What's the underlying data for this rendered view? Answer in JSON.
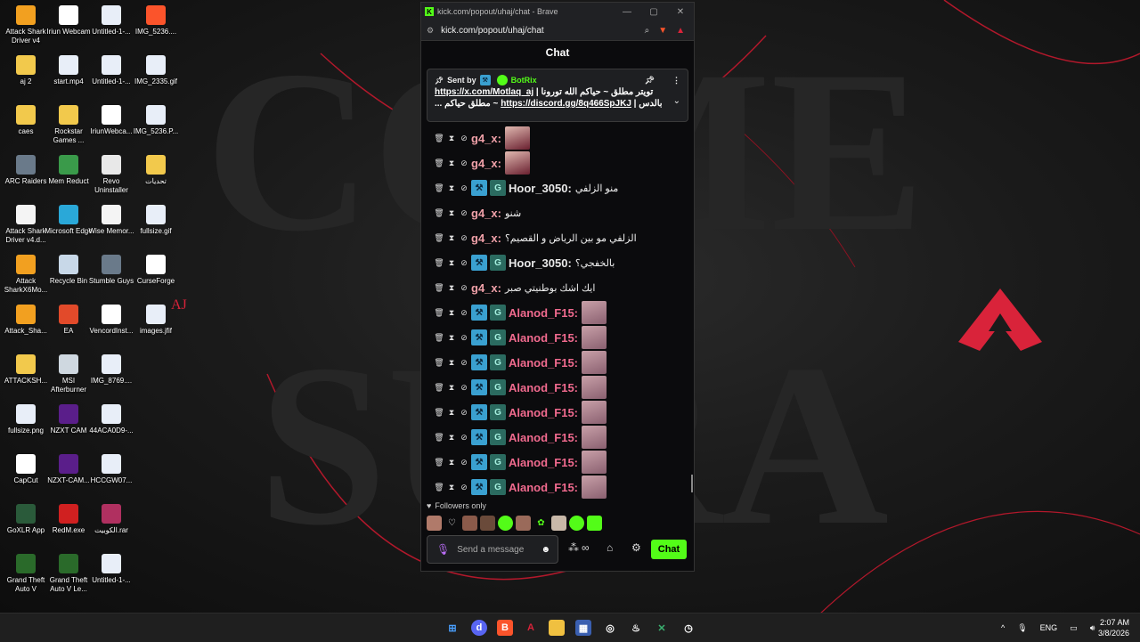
{
  "wallpaper": {
    "letters_top": "COME",
    "letters_bottom": "SURA"
  },
  "desktop_icons": [
    {
      "label": "Attack Shark Driver v4",
      "icon": "mouse-driver-icon"
    },
    {
      "label": "Iriun Webcam",
      "icon": "webcam-icon"
    },
    {
      "label": "Untitled-1-...",
      "icon": "image-file-icon"
    },
    {
      "label": "IMG_5236....",
      "icon": "brave-icon"
    },
    {
      "label": "aj 2",
      "icon": "folder-icon"
    },
    {
      "label": "start.mp4",
      "icon": "video-file-icon"
    },
    {
      "label": "Untitled-1-...",
      "icon": "image-file-icon"
    },
    {
      "label": "IMG_2335.gif",
      "icon": "image-file-icon"
    },
    {
      "label": "caes",
      "icon": "folder-icon"
    },
    {
      "label": "Rockstar Games ...",
      "icon": "rockstar-icon"
    },
    {
      "label": "IriunWebca...",
      "icon": "webcam-icon"
    },
    {
      "label": "IMG_5236.P...",
      "icon": "image-file-icon"
    },
    {
      "label": "ARC Raiders",
      "icon": "game-icon"
    },
    {
      "label": "Mem Reduct",
      "icon": "memory-icon"
    },
    {
      "label": "Revo Uninstaller",
      "icon": "uninstaller-icon"
    },
    {
      "label": "تحديات",
      "icon": "folder-icon"
    },
    {
      "label": "Attack Shark Driver v4.d...",
      "icon": "document-icon"
    },
    {
      "label": "Microsoft Edge",
      "icon": "edge-icon"
    },
    {
      "label": "Wise Memor...",
      "icon": "document-icon"
    },
    {
      "label": "fullsize.gif",
      "icon": "image-file-icon"
    },
    {
      "label": "Attack SharkX6Mo...",
      "icon": "mouse-driver-icon"
    },
    {
      "label": "Recycle Bin",
      "icon": "recycle-bin-icon"
    },
    {
      "label": "Stumble Guys",
      "icon": "game-icon"
    },
    {
      "label": "CurseForge",
      "icon": "curseforge-icon"
    },
    {
      "label": "Attack_Sha...",
      "icon": "mouse-driver-icon"
    },
    {
      "label": "EA",
      "icon": "ea-icon"
    },
    {
      "label": "VencordInst...",
      "icon": "vencord-icon"
    },
    {
      "label": "images.jfif",
      "icon": "image-file-icon"
    },
    {
      "label": "ATTACKSH...",
      "icon": "folder-icon"
    },
    {
      "label": "MSI Afterburner",
      "icon": "afterburner-icon"
    },
    {
      "label": "IMG_8769....",
      "icon": "image-file-icon"
    },
    {
      "label": "fullsize.png",
      "icon": "image-file-icon"
    },
    {
      "label": "NZXT CAM",
      "icon": "nzxt-icon"
    },
    {
      "label": "44ACA0D9-...",
      "icon": "image-file-icon"
    },
    {
      "label": "CapCut",
      "icon": "capcut-icon"
    },
    {
      "label": "NZXT-CAM...",
      "icon": "nzxt-icon"
    },
    {
      "label": "HCCGW07...",
      "icon": "image-file-icon"
    },
    {
      "label": "GoXLR App",
      "icon": "goxlr-icon"
    },
    {
      "label": "RedM.exe",
      "icon": "redm-icon"
    },
    {
      "label": "الكوبيت.rar",
      "icon": "archive-icon"
    },
    {
      "label": "Grand Theft Auto V",
      "icon": "gta-icon"
    },
    {
      "label": "Grand Theft Auto V Le...",
      "icon": "gta-icon"
    },
    {
      "label": "Untitled-1-...",
      "icon": "image-file-icon"
    }
  ],
  "browser": {
    "title": "kick.com/popout/uhaj/chat - Brave",
    "url": "kick.com/popout/uhaj/chat",
    "min": "—",
    "max": "▢",
    "close": "✕"
  },
  "chat": {
    "header": "Chat",
    "pinned": {
      "sent_by": "Sent by",
      "bot": "BotRix",
      "line1_link": "https://x.com/Motlaq_aj",
      "line1_rest": " | تويتر مطلق ~ حياكم الله تورونا",
      "line2_prefix": "... مطلق حياكم ~ ",
      "line2_link": "https://discord.gg/8q466SpJKJ",
      "line2_rest": " | بالدس"
    },
    "messages": [
      {
        "user": "g4_x:",
        "color": "#f0a0a8",
        "text": "",
        "badges": false,
        "emote": true
      },
      {
        "user": "g4_x:",
        "color": "#f0a0a8",
        "text": "",
        "badges": false,
        "emote": true
      },
      {
        "user": "Hoor_3050:",
        "color": "#e8e8e8",
        "text": "منو الزلفي",
        "badges": true,
        "emote": false
      },
      {
        "user": "g4_x:",
        "color": "#f0a0a8",
        "text": "شنو",
        "badges": false,
        "emote": false
      },
      {
        "user": "g4_x:",
        "color": "#f0a0a8",
        "text": "الزلفي مو بين الرياض و القصيم؟",
        "badges": false,
        "emote": false
      },
      {
        "user": "Hoor_3050:",
        "color": "#e8e8e8",
        "text": "بالخفجي؟",
        "badges": true,
        "emote": false
      },
      {
        "user": "g4_x:",
        "color": "#f0a0a8",
        "text": "ايك اشك بوطنيتي صبر",
        "badges": false,
        "emote": false
      },
      {
        "user": "Alanod_F15:",
        "color": "#f06a8e",
        "text": "",
        "badges": true,
        "emote": true
      },
      {
        "user": "Alanod_F15:",
        "color": "#f06a8e",
        "text": "",
        "badges": true,
        "emote": true
      },
      {
        "user": "Alanod_F15:",
        "color": "#f06a8e",
        "text": "",
        "badges": true,
        "emote": true
      },
      {
        "user": "Alanod_F15:",
        "color": "#f06a8e",
        "text": "",
        "badges": true,
        "emote": true
      },
      {
        "user": "Alanod_F15:",
        "color": "#f06a8e",
        "text": "",
        "badges": true,
        "emote": true
      },
      {
        "user": "Alanod_F15:",
        "color": "#f06a8e",
        "text": "",
        "badges": true,
        "emote": true
      },
      {
        "user": "Alanod_F15:",
        "color": "#f06a8e",
        "text": "",
        "badges": true,
        "emote": true
      },
      {
        "user": "Alanod_F15:",
        "color": "#f06a8e",
        "text": "",
        "badges": true,
        "emote": true
      }
    ],
    "followers_only": "Followers only",
    "input_placeholder": "Send a message",
    "send_label": "Chat",
    "infinity": "∞"
  },
  "taskbar": {
    "lang": "ENG",
    "time": "2:07 AM",
    "date": "3/8/2026"
  },
  "colors": {
    "kick_green": "#53fc18",
    "pink_user": "#f06a8e",
    "wallpaper_red": "#d9233a"
  }
}
